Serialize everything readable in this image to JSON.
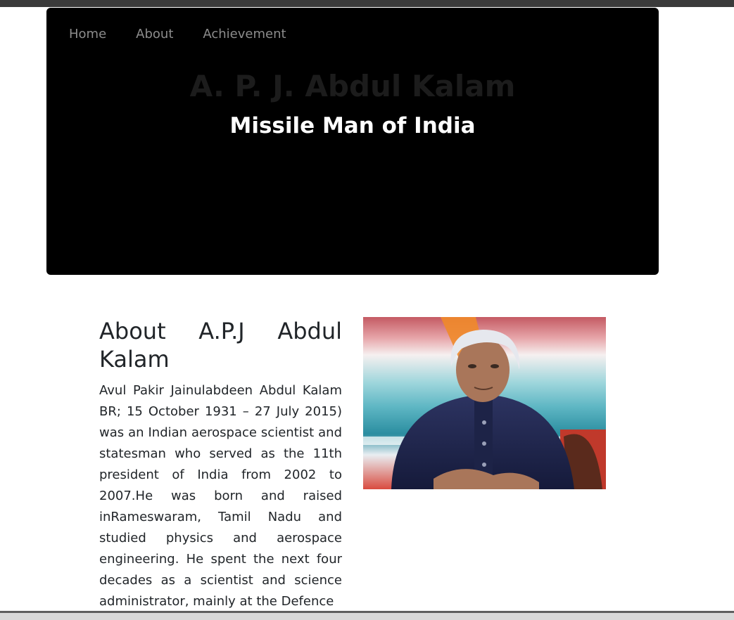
{
  "nav": {
    "items": [
      {
        "label": "Home"
      },
      {
        "label": "About"
      },
      {
        "label": "Achievement"
      }
    ]
  },
  "hero": {
    "title": "A. P. J. Abdul Kalam",
    "subtitle": "Missile Man of India"
  },
  "about": {
    "heading": "About A.P.J Abdul Kalam",
    "text": "Avul Pakir Jainulabdeen Abdul Kalam BR; 15 October 1931 – 27 July 2015) was an Indian aerospace scientist and statesman who served as the 11th president of India from 2002 to 2007.He was born and raised inRameswaram, Tamil Nadu and studied physics and aerospace engineering. He spent the next four decades as a scientist and science administrator, mainly at the Defence"
  },
  "colors": {
    "hero_background": "#000000",
    "nav_link": "#8c8c8c",
    "hero_title": "#1c1c1c",
    "hero_subtitle": "#ffffff",
    "body_text": "#212529"
  }
}
